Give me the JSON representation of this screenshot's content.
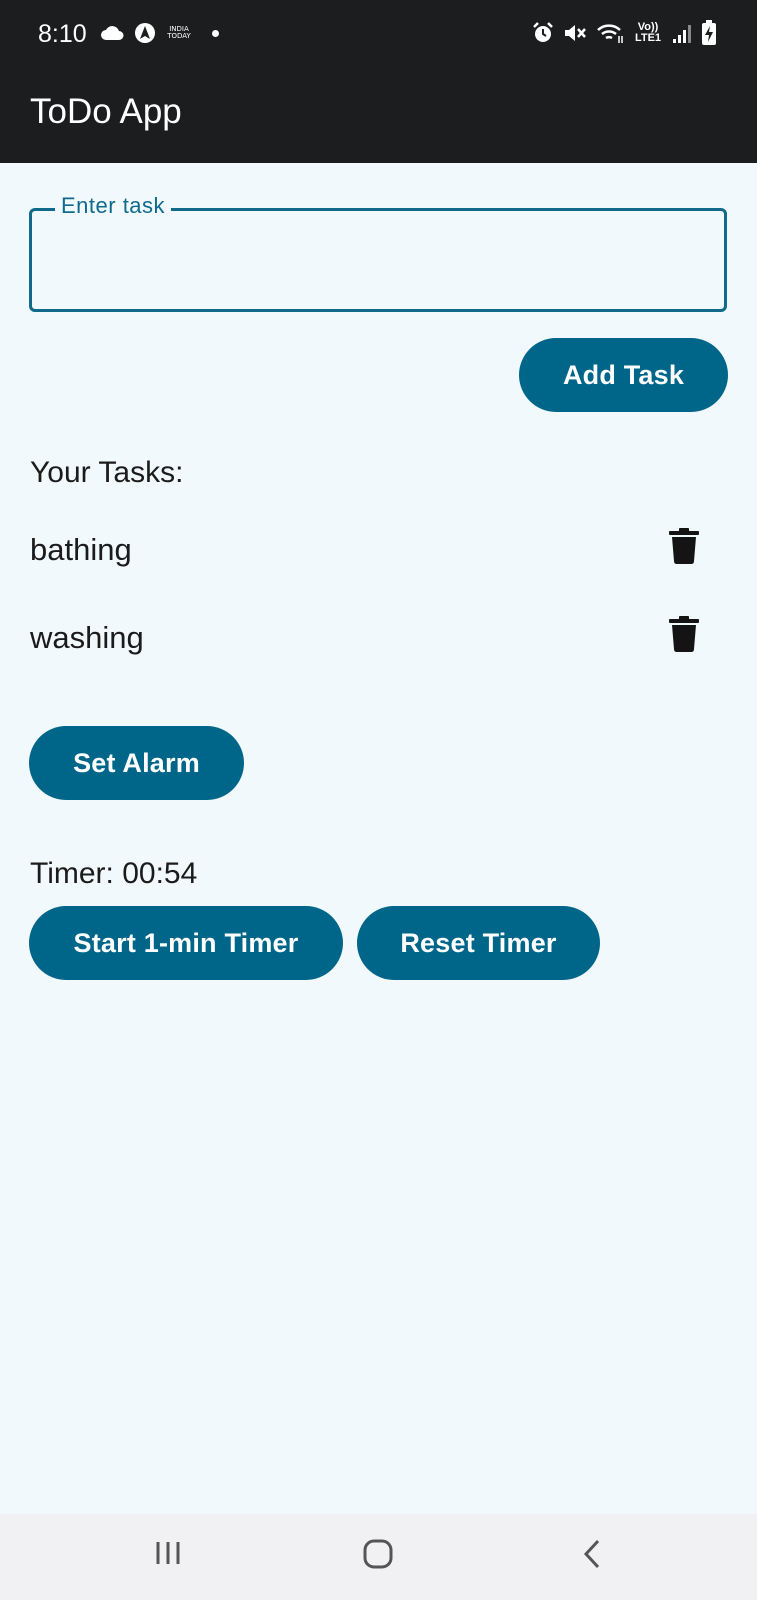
{
  "status_bar": {
    "time": "8:10",
    "left_icons": [
      "cloud-icon",
      "navigation-app-icon",
      "news-app-icon",
      "notification-dot-icon"
    ],
    "news_icon_text": [
      "INDIA",
      "TODAY"
    ],
    "right_icons": [
      "alarm-icon",
      "mute-icon",
      "wifi-icon",
      "volte-icon",
      "signal-icon",
      "battery-charging-icon"
    ],
    "volte_text": [
      "Vo))",
      "LTE1"
    ]
  },
  "app_bar": {
    "title": "ToDo App"
  },
  "task_input": {
    "label": "Enter task",
    "value": "",
    "placeholder": ""
  },
  "add_task_button": {
    "label": "Add Task"
  },
  "tasks": {
    "heading": "Your Tasks:",
    "items": [
      {
        "text": "bathing",
        "delete_icon": "trash-icon"
      },
      {
        "text": "washing",
        "delete_icon": "trash-icon"
      }
    ]
  },
  "set_alarm_button": {
    "label": "Set Alarm"
  },
  "timer": {
    "label": "Timer: 00:54",
    "start_label": "Start 1-min Timer",
    "reset_label": "Reset Timer"
  },
  "nav_bar": {
    "icons": [
      "recent-apps-icon",
      "home-icon",
      "back-icon"
    ]
  },
  "colors": {
    "app_bar": "#1c1d1f",
    "background": "#f1f9fc",
    "accent": "#006689",
    "outline": "#0f6a8b",
    "text": "#1b1b1b"
  }
}
